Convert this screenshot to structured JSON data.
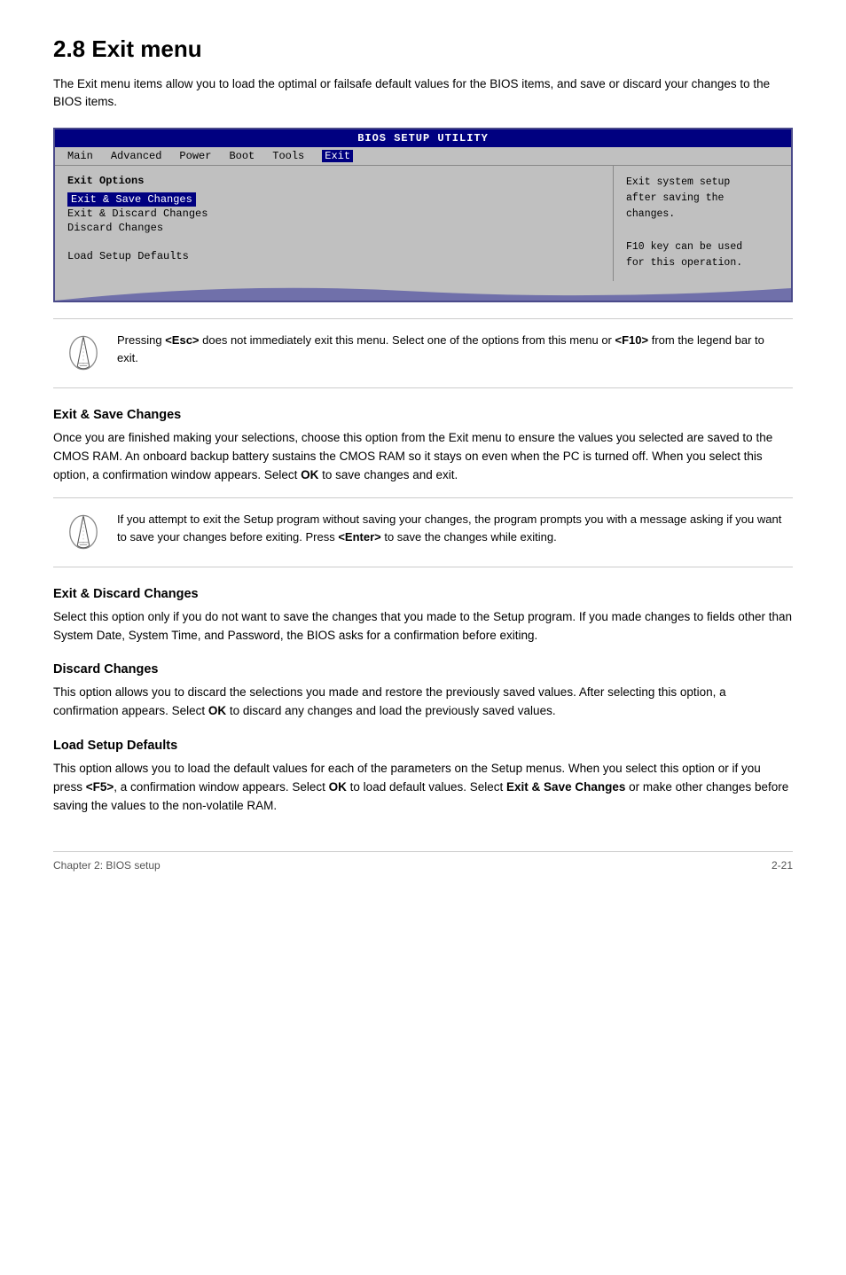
{
  "page": {
    "title": "2.8   Exit menu",
    "intro": "The Exit menu items allow you to load the optimal or failsafe default values for the BIOS items, and save or discard your changes to the BIOS items.",
    "footer_left": "Chapter 2: BIOS setup",
    "footer_right": "2-21"
  },
  "bios_ui": {
    "title": "BIOS SETUP UTILITY",
    "nav_items": [
      "Main",
      "Advanced",
      "Power",
      "Boot",
      "Tools",
      "Exit"
    ],
    "active_nav": "Exit",
    "section_title": "Exit Options",
    "menu_items": [
      {
        "label": "Exit & Save Changes",
        "selected": true
      },
      {
        "label": "Exit & Discard Changes",
        "selected": false
      },
      {
        "label": "Discard Changes",
        "selected": false
      },
      {
        "label": "",
        "selected": false
      },
      {
        "label": "Load Setup Defaults",
        "selected": false
      }
    ],
    "help_text": "Exit system setup\nafter saving the\nchanges.\n\nF10 key can be used\nfor this operation."
  },
  "note1": {
    "text": "Pressing <Esc> does not immediately exit this menu. Select one of the options from this menu or <F10> from the legend bar to exit."
  },
  "sections": [
    {
      "id": "exit-save",
      "heading": "Exit & Save Changes",
      "text": "Once you are finished making your selections, choose this option from the Exit menu to ensure the values you selected are saved to the CMOS RAM. An onboard backup battery sustains the CMOS RAM so it stays on even when the PC is turned off. When you select this option, a confirmation window appears. Select OK to save changes and exit."
    }
  ],
  "note2": {
    "text1": "If you attempt to exit the Setup program without saving your changes, the program prompts you with a message asking if you want to save your changes before exiting. Press ",
    "bold": "<Enter>",
    "text2": " to save the  changes while exiting."
  },
  "sections2": [
    {
      "id": "exit-discard",
      "heading": "Exit & Discard Changes",
      "text": "Select this option only if you do not want to save the changes that you  made to the Setup program. If you made changes to fields other than System Date, System Time, and Password, the BIOS asks for a confirmation before exiting."
    },
    {
      "id": "discard-changes",
      "heading": "Discard Changes",
      "text": "This option allows you to discard the selections you made and restore the previously saved values. After selecting this option, a confirmation appears. Select <b>OK</b> to discard any changes and load the previously saved values."
    },
    {
      "id": "load-defaults",
      "heading": "Load Setup Defaults",
      "text": "This option allows you to load the default values for each of the parameters on the Setup menus. When you select this option or if you press <b>&lt;F5&gt;</b>, a confirmation window appears. Select <b>OK</b> to load default values. Select <b>Exit &amp; Save Changes</b> or make other changes before saving the values to the non-volatile RAM."
    }
  ]
}
